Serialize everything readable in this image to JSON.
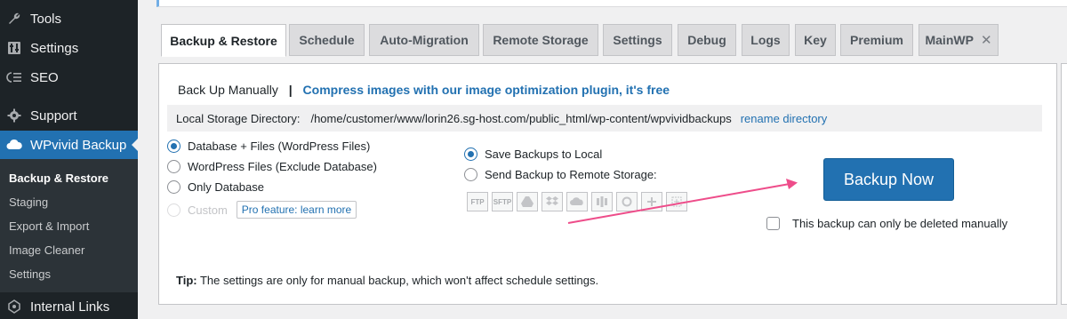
{
  "sidebar": {
    "items": [
      {
        "label": "Tools",
        "icon": "wrench-icon"
      },
      {
        "label": "Settings",
        "icon": "settings-icon"
      },
      {
        "label": "SEO",
        "icon": "seo-icon"
      },
      {
        "label": "Support",
        "icon": "gear-icon"
      },
      {
        "label": "WPvivid Backup",
        "icon": "cloud-icon"
      },
      {
        "label": "Internal Links",
        "icon": "links-icon"
      }
    ],
    "submenu": [
      "Backup & Restore",
      "Staging",
      "Export & Import",
      "Image Cleaner",
      "Settings"
    ]
  },
  "tabs": [
    {
      "label": "Backup & Restore",
      "active": true
    },
    {
      "label": "Schedule"
    },
    {
      "label": "Auto-Migration"
    },
    {
      "label": "Remote Storage"
    },
    {
      "label": "Settings"
    },
    {
      "label": "Debug"
    },
    {
      "label": "Logs"
    },
    {
      "label": "Key"
    },
    {
      "label": "Premium"
    },
    {
      "label": "MainWP",
      "close": "✕"
    }
  ],
  "panel": {
    "title": "Back Up Manually",
    "separator": "|",
    "promo_link": "Compress images with our image optimization plugin, it's free",
    "storage_label": "Local Storage Directory:",
    "storage_path": "/home/customer/www/lorin26.sg-host.com/public_html/wp-content/wpvividbackups",
    "rename_link": "rename directory",
    "backup_options": [
      {
        "label": "Database + Files (WordPress Files)",
        "checked": true
      },
      {
        "label": "WordPress Files (Exclude Database)",
        "checked": false
      },
      {
        "label": "Only Database",
        "checked": false
      },
      {
        "label": "Custom",
        "checked": false,
        "disabled": true
      }
    ],
    "pro_badge": "Pro feature: learn more",
    "destination_options": [
      {
        "label": "Save Backups to Local",
        "checked": true
      },
      {
        "label": "Send Backup to Remote Storage:",
        "checked": false
      }
    ],
    "storage_icons": [
      "FTP",
      "SFTP",
      "google-drive-icon",
      "dropbox-icon",
      "onedrive-icon",
      "s3-icon",
      "backblaze-icon",
      "webdav-icon",
      "add-icon"
    ],
    "backup_button": "Backup Now",
    "manual_delete_label": "This backup can only be deleted manually",
    "tip_label": "Tip:",
    "tip_text": " The settings are only for manual backup, which won't affect schedule settings."
  },
  "colors": {
    "accent": "#2271b1",
    "sidebar_bg": "#1d2327",
    "annotation_arrow": "#ee4d8a"
  }
}
